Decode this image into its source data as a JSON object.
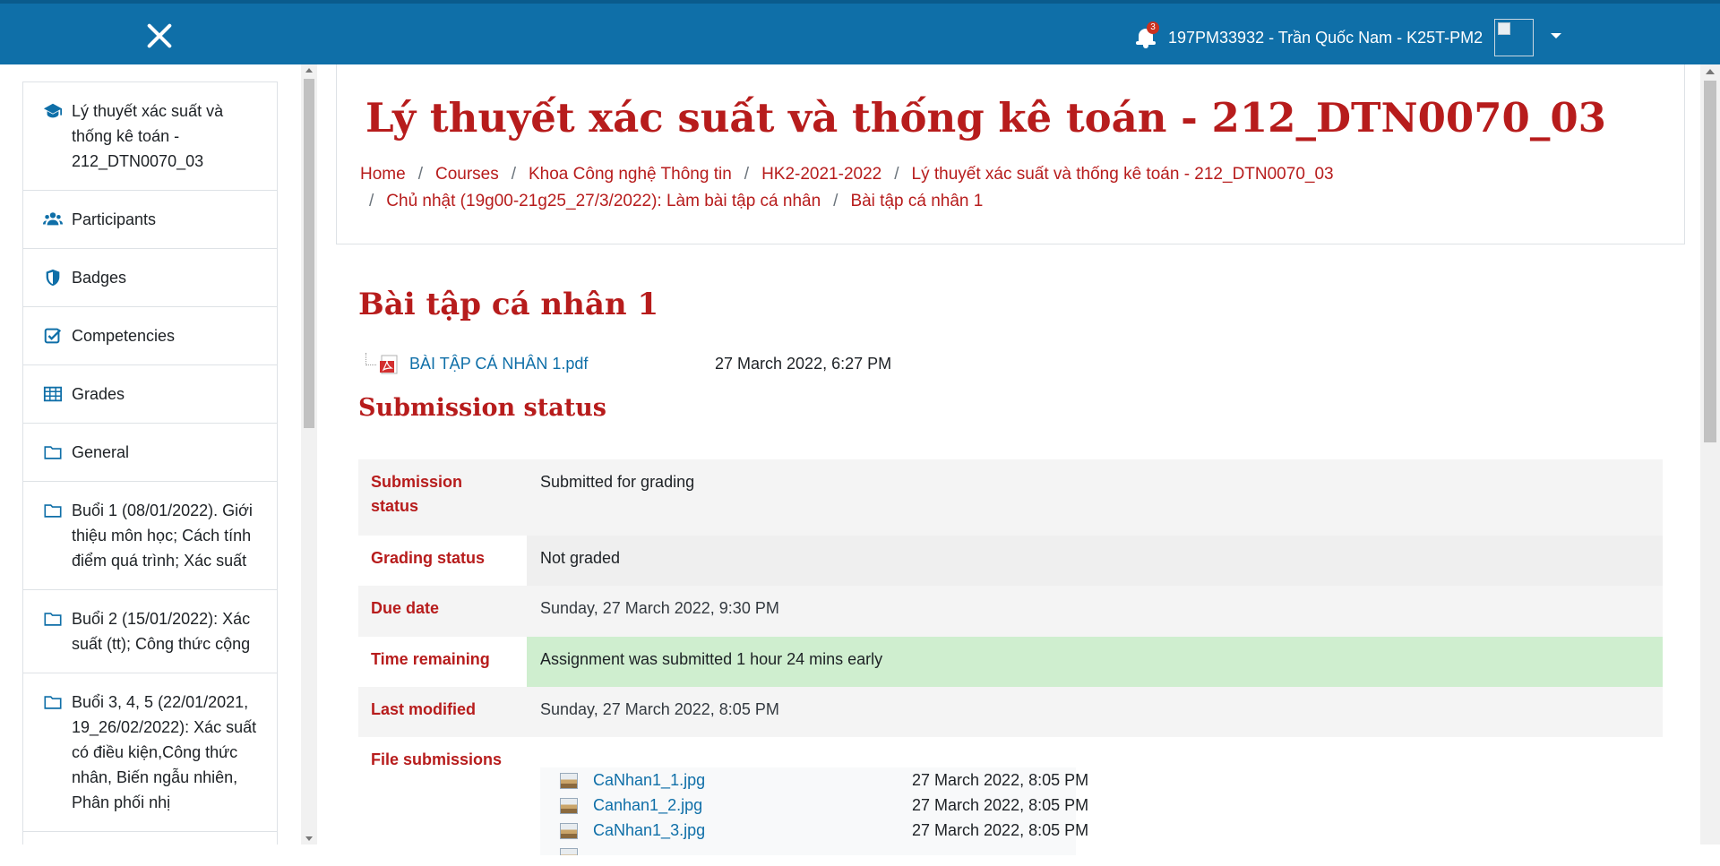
{
  "topbar": {
    "notification_count": "3",
    "user_name": "197PM33932 - Trần Quốc Nam - K25T-PM2",
    "colors": {
      "bar": "#0f6fa8",
      "badge": "#ca3120"
    }
  },
  "sidebar": {
    "items": [
      {
        "label": "Lý thuyết xác suất và thống kê toán - 212_DTN0070_03",
        "icon": "graduation-cap-icon"
      },
      {
        "label": "Participants",
        "icon": "users-icon"
      },
      {
        "label": "Badges",
        "icon": "shield-icon"
      },
      {
        "label": "Competencies",
        "icon": "check-square-icon"
      },
      {
        "label": "Grades",
        "icon": "table-icon"
      },
      {
        "label": "General",
        "icon": "folder-icon"
      },
      {
        "label": "Buổi 1 (08/01/2022). Giới thiệu môn học; Cách tính điểm quá trình; Xác suất",
        "icon": "folder-icon"
      },
      {
        "label": "Buổi 2 (15/01/2022): Xác suất (tt); Công thức cộng",
        "icon": "folder-icon"
      },
      {
        "label": "Buổi 3, 4, 5 (22/01/2021, 19_26/02/2022): Xác suất có điều kiện,Công thức nhân, Biến ngẫu nhiên, Phân phối nhị",
        "icon": "folder-icon"
      }
    ]
  },
  "header": {
    "course_title": "Lý thuyết xác suất và thống kê toán - 212_DTN0070_03",
    "breadcrumb": [
      "Home",
      "Courses",
      "Khoa Công nghệ Thông tin",
      "HK2-2021-2022",
      "Lý thuyết xác suất và thống kê toán - 212_DTN0070_03",
      "Chủ nhật (19g00-21g25_27/3/2022): Làm bài tập cá nhân",
      "Bài tập cá nhân 1"
    ]
  },
  "main": {
    "heading": "Bài tập cá nhân 1",
    "attachment": {
      "name": "BÀI TẬP CÁ NHÂN 1.pdf",
      "date": "27 March 2022, 6:27 PM",
      "icon": "pdf-icon"
    },
    "section_heading": "Submission status",
    "status_rows": [
      {
        "label": "Submission status",
        "value": "Submitted for grading"
      },
      {
        "label": "Grading status",
        "value": "Not graded"
      },
      {
        "label": "Due date",
        "value": "Sunday, 27 March 2022, 9:30 PM"
      },
      {
        "label": "Time remaining",
        "value": "Assignment was submitted 1 hour 24 mins early"
      },
      {
        "label": "Last modified",
        "value": "Sunday, 27 March 2022, 8:05 PM"
      },
      {
        "label": "File submissions"
      }
    ],
    "files": [
      {
        "name": "CaNhan1_1.jpg",
        "date": "27 March 2022, 8:05 PM",
        "icon": "image-file-icon"
      },
      {
        "name": "Canhan1_2.jpg",
        "date": "27 March 2022, 8:05 PM",
        "icon": "image-file-icon"
      },
      {
        "name": "CaNhan1_3.jpg",
        "date": "27 March 2022, 8:05 PM",
        "icon": "image-file-icon"
      }
    ],
    "colors": {
      "accent": "#b71c1c",
      "link": "#0f6fa8",
      "success_bg": "#cfeecf"
    }
  }
}
